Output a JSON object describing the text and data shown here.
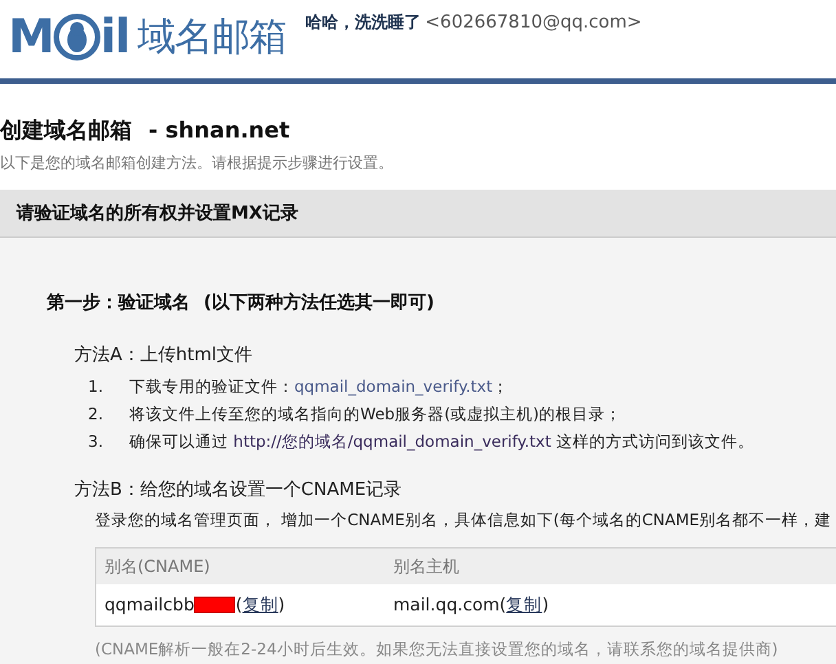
{
  "header": {
    "logo": {
      "left": "M",
      "right": "il"
    },
    "product": "域名邮箱",
    "user": {
      "name": "哈哈，洗洗睡了",
      "email": "<602667810@qq.com>"
    }
  },
  "page": {
    "title": "创建域名邮箱",
    "domain": "- shnan.net",
    "subtitle": "以下是您的域名邮箱创建方法。请根据提示步骤进行设置。"
  },
  "panel": {
    "heading": "请验证域名的所有权并设置MX记录",
    "step": {
      "title": "第一步：验证域名",
      "hint": "(以下两种方法任选其一即可)"
    },
    "method_a": {
      "title": "方法A：上传html文件",
      "items": [
        {
          "number": "1.",
          "text": "下载专用的验证文件：",
          "link": "qqmail_domain_verify.txt",
          "after": "；"
        },
        {
          "number": "2.",
          "text": "将该文件上传至您的域名指向的Web服务器(或虚拟主机)的根目录；"
        },
        {
          "number": "3.",
          "text": "确保可以通过  ",
          "url": "http://您的域名/qqmail_domain_verify.txt",
          "after": " 这样的方式访问到该文件。"
        }
      ]
    },
    "method_b": {
      "title": "方法B：给您的域名设置一个CNAME记录",
      "description": "登录您的域名管理页面， 增加一个CNAME别名，具体信息如下(每个域名的CNAME别名都不一样，建",
      "table": {
        "columns": [
          "别名(CNAME)",
          "别名主机"
        ],
        "rows": [
          [
            {
              "value": "qqmailcbb",
              "redacted": true,
              "open": "(",
              "link": "复制",
              "close": ")"
            },
            {
              "value": "mail.qq.com",
              "redacted": false,
              "open": "(",
              "link": "复制",
              "close": ")"
            }
          ]
        ]
      },
      "note": "(CNAME解析一般在2-24小时后生效。如果您无法直接设置您的域名，请联系您的域名提供商)"
    }
  }
}
